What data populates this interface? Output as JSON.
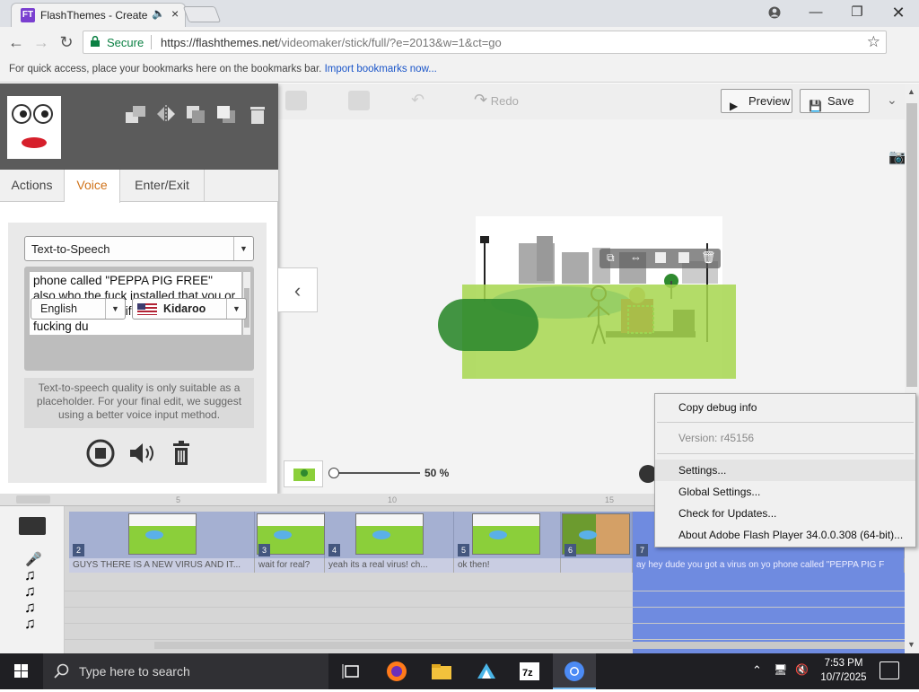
{
  "browser": {
    "tab_title": "FlashThemes - Create",
    "favicon_text": "FT",
    "window_controls": [
      "minimize",
      "restore",
      "close"
    ],
    "security_label": "Secure",
    "url_prefix": "https://flashthemes.net",
    "url_path": "/videomaker/stick/full/?e=2013&w=1&ct=go",
    "bookmarks_text": "For quick access, place your bookmarks here on the bookmarks bar.",
    "bookmarks_link": "Import bookmarks now..."
  },
  "toolbar": {
    "redo_label": "Redo",
    "preview_label": "Preview",
    "save_label": "Save"
  },
  "panel": {
    "tabs": [
      {
        "label": "Actions",
        "active": false
      },
      {
        "label": "Voice",
        "active": true
      },
      {
        "label": "Enter/Exit",
        "active": false
      }
    ],
    "tts_mode": "Text-to-Speech",
    "tts_text": "phone called \"PEPPA PIG FREE\" also who the fuck installed that you or your son becuse if you did your so fucking du",
    "language": "English",
    "voice": "Kidaroo",
    "note": "Text-to-speech quality is only suitable as a placeholder. For your final edit, we suggest using a better voice input method."
  },
  "zoom": {
    "percent_label": "50 %",
    "level": 0.5
  },
  "timeline": {
    "ruler_ticks": [
      "5",
      "10",
      "15"
    ],
    "scenes": [
      {
        "num": "2",
        "caption": "GUYS THERE IS A NEW VIRUS AND IT..."
      },
      {
        "num": "3",
        "caption": "wait for real?"
      },
      {
        "num": "4",
        "caption": "yeah its a real virus! ch..."
      },
      {
        "num": "5",
        "caption": "ok then!"
      },
      {
        "num": "6",
        "caption": ""
      },
      {
        "num": "7",
        "caption": "ay hey dude you got a virus on yo phone called \"PEPPA PIG F"
      }
    ]
  },
  "context_menu": {
    "items": [
      {
        "label": "Copy debug info",
        "enabled": true
      },
      {
        "label": "Version: r45156",
        "enabled": false
      },
      {
        "label": "Settings...",
        "enabled": true,
        "highlighted": true
      },
      {
        "label": "Global Settings...",
        "enabled": true
      },
      {
        "label": "Check for Updates...",
        "enabled": true
      },
      {
        "label": "About Adobe Flash Player 34.0.0.308 (64-bit)...",
        "enabled": true
      }
    ]
  },
  "taskbar": {
    "search_placeholder": "Type here to search",
    "time": "7:53 PM",
    "date": "10/7/2025"
  }
}
